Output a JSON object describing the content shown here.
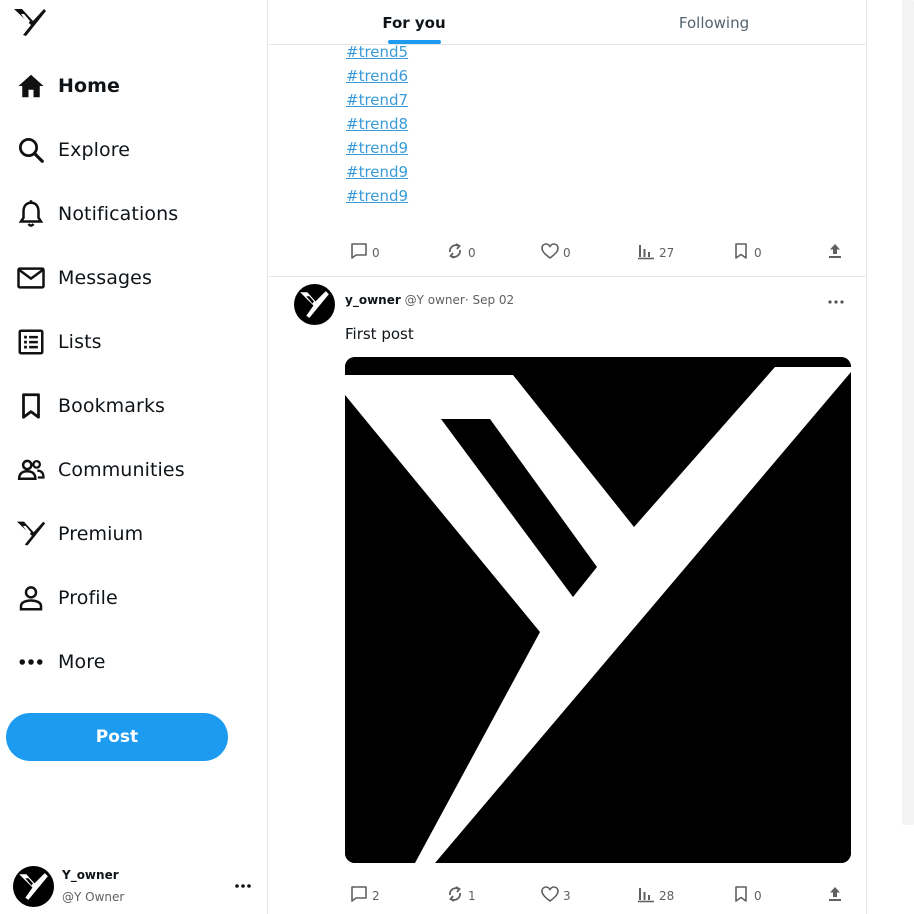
{
  "brand": {
    "logo_icon": "y-logo-icon",
    "accent_color": "#1d9bf0"
  },
  "sidebar": {
    "items": [
      {
        "label": "Home",
        "icon": "home-icon",
        "active": true
      },
      {
        "label": "Explore",
        "icon": "search-icon"
      },
      {
        "label": "Notifications",
        "icon": "bell-icon"
      },
      {
        "label": "Messages",
        "icon": "mail-icon"
      },
      {
        "label": "Lists",
        "icon": "list-icon"
      },
      {
        "label": "Bookmarks",
        "icon": "bookmark-icon"
      },
      {
        "label": "Communities",
        "icon": "people-icon"
      },
      {
        "label": "Premium",
        "icon": "y-logo-icon"
      },
      {
        "label": "Profile",
        "icon": "person-icon"
      },
      {
        "label": "More",
        "icon": "more-dots-icon"
      }
    ],
    "post_button": "Post",
    "account": {
      "name": "Y_owner",
      "handle": "@Y Owner"
    }
  },
  "tabs": [
    {
      "label": "For you",
      "active": true
    },
    {
      "label": "Following",
      "active": false
    }
  ],
  "feed": {
    "previous_post": {
      "hashtags": [
        "#trend5",
        "#trend6",
        "#trend7",
        "#trend8",
        "#trend9",
        "#trend9",
        "#trend9"
      ],
      "stats": {
        "replies": "0",
        "reposts": "0",
        "likes": "0",
        "views": "27",
        "bookmarks": "0"
      }
    },
    "post": {
      "name": "y_owner",
      "handle": "@Y owner",
      "separator": "·",
      "date": "Sep 02",
      "text": "First post",
      "media": "y-logo-image",
      "stats": {
        "replies": "2",
        "reposts": "1",
        "likes": "3",
        "views": "28",
        "bookmarks": "0"
      }
    }
  }
}
